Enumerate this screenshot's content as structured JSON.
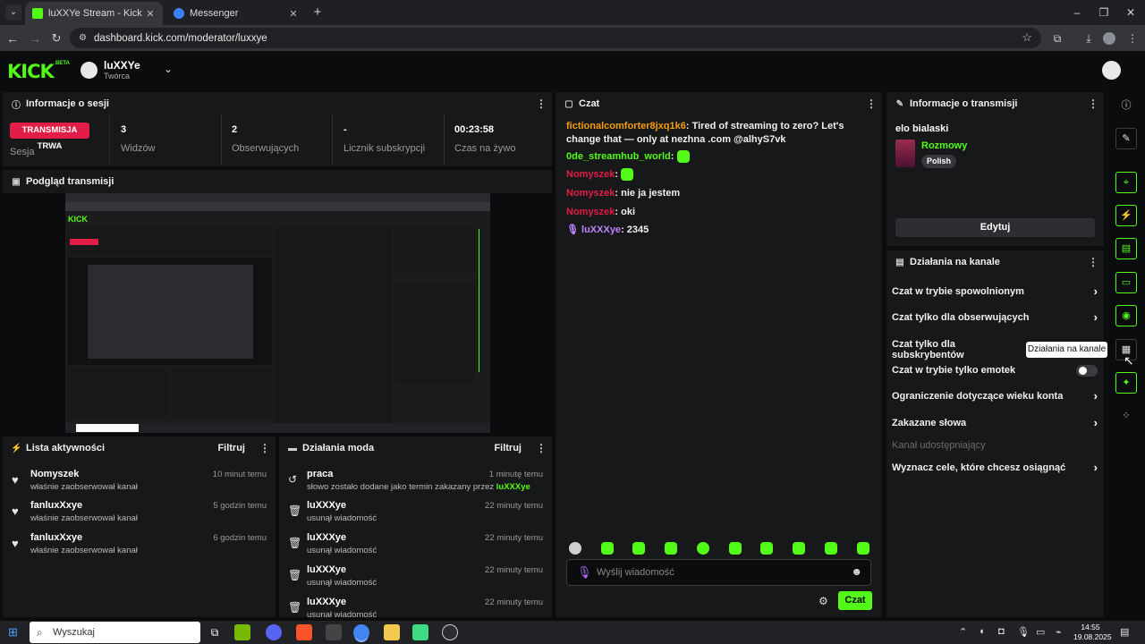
{
  "browser": {
    "tabs": [
      {
        "title": "luXXYe Stream - Kick Dashbo",
        "active": true
      },
      {
        "title": "Messenger",
        "active": false
      }
    ],
    "url": "dashboard.kick.com/moderator/luxxye"
  },
  "header": {
    "logo": "KICK",
    "beta": "BETA",
    "channel_name": "luXXYe",
    "channel_role": "Twórca"
  },
  "session": {
    "title": "Informacje o sesji",
    "badge": "TRANSMISJA TRWA",
    "badge_label": "Sesja",
    "stats": [
      {
        "value": "3",
        "label": "Widzów"
      },
      {
        "value": "2",
        "label": "Obserwujących"
      },
      {
        "value": "-",
        "label": "Licznik subskrypcji"
      },
      {
        "value": "00:23:58",
        "label": "Czas na żywo"
      }
    ]
  },
  "preview": {
    "title": "Podgląd transmisji"
  },
  "activity": {
    "title": "Lista aktywności",
    "filter": "Filtruj",
    "items": [
      {
        "name": "Nomyszek",
        "sub": "właśnie zaobserwował kanał",
        "time": "10 minut temu"
      },
      {
        "name": "fanluxXxye",
        "sub": "właśnie zaobserwował kanał",
        "time": "5 godzin temu"
      },
      {
        "name": "fanluxXxye",
        "sub": "właśnie zaobserwował kanał",
        "time": "6 godzin temu"
      }
    ]
  },
  "mod": {
    "title": "Działania moda",
    "filter": "Filtruj",
    "items": [
      {
        "name": "praca",
        "sub": "słowo zostało dodane jako termin zakazany przez",
        "sub_user": "luXXXye",
        "time": "1 minutę temu",
        "icon": "undo"
      },
      {
        "name": "luXXXye",
        "sub": "usunął wiadomość",
        "time": "22 minuty temu",
        "icon": "trash"
      },
      {
        "name": "luXXXye",
        "sub": "usunął wiadomość",
        "time": "22 minuty temu",
        "icon": "trash"
      },
      {
        "name": "luXXXye",
        "sub": "usunął wiadomość",
        "time": "22 minuty temu",
        "icon": "trash"
      },
      {
        "name": "luXXXye",
        "sub": "usunął wiadomość",
        "time": "22 minuty temu",
        "icon": "trash"
      }
    ]
  },
  "chat": {
    "title": "Czat",
    "messages": [
      {
        "user": "fictionalcomforter8jxq1k6",
        "color": "#f59e0b",
        "text": "Tired of streaming to zero? Let's change that — only at nezhna .com @alhyS7vk"
      },
      {
        "user": "0de_streamhub_world",
        "color": "#53fc18",
        "text": ""
      },
      {
        "user": "Nomyszek",
        "color": "#e11d48",
        "text": ""
      },
      {
        "user": "Nomyszek",
        "color": "#e11d48",
        "text": "nie ja jestem"
      },
      {
        "user": "Nomyszek",
        "color": "#e11d48",
        "text": "oki"
      },
      {
        "user": "luXXXye",
        "color": "#c084fc",
        "text": "2345"
      }
    ],
    "input_placeholder": "Wyślij wiadomość",
    "send_label": "Czat"
  },
  "stream_info": {
    "title": "Informacje o transmisji",
    "stream_title": "elo bialaski",
    "category": "Rozmowy",
    "language": "Polish",
    "edit_label": "Edytuj"
  },
  "channel_actions": {
    "title": "Działania na kanale",
    "items": [
      {
        "label": "Czat w trybie spowolnionym",
        "type": "chevron"
      },
      {
        "label": "Czat tylko dla obserwujących",
        "type": "chevron"
      },
      {
        "label": "Czat tylko dla subskrybentów",
        "type": "chevron"
      },
      {
        "label": "Czat w trybie tylko emotek",
        "type": "toggle"
      },
      {
        "label": "Ograniczenie dotyczące wieku konta",
        "type": "chevron"
      },
      {
        "label": "Zakazane słowa",
        "type": "chevron"
      },
      {
        "label": "Kanał udostępniający",
        "type": "muted"
      },
      {
        "label": "Wyznacz cele, które chcesz osiągnąć",
        "type": "chevron"
      }
    ],
    "tooltip": "Działania na kanale"
  },
  "taskbar": {
    "search_placeholder": "Wyszukaj",
    "time": "14:55",
    "date": "19.08.2025"
  },
  "colors": {
    "accent": "#53fc18",
    "live": "#e11d48"
  }
}
